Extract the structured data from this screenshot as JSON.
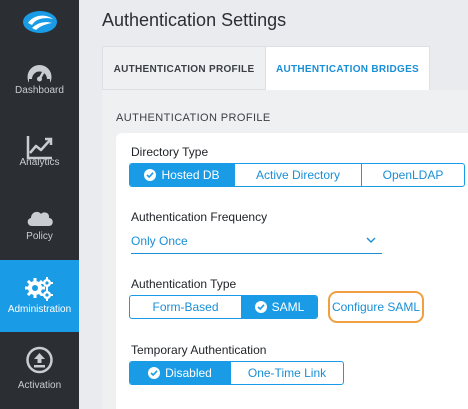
{
  "sidebar": {
    "items": [
      {
        "label": "Dashboard",
        "icon": "dashboard-gauge-icon"
      },
      {
        "label": "Analytics",
        "icon": "analytics-chart-icon"
      },
      {
        "label": "Policy",
        "icon": "cloud-icon"
      },
      {
        "label": "Administration",
        "icon": "gears-icon",
        "active": true
      },
      {
        "label": "Activation",
        "icon": "upload-icon"
      }
    ]
  },
  "header": {
    "title": "Authentication Settings"
  },
  "tabs": [
    {
      "label": "AUTHENTICATION PROFILE"
    },
    {
      "label": "AUTHENTICATION BRIDGES"
    }
  ],
  "section": {
    "title": "AUTHENTICATION PROFILE"
  },
  "directory_type": {
    "label": "Directory Type",
    "options": [
      "Hosted DB",
      "Active Directory",
      "OpenLDAP"
    ],
    "selected": "Hosted DB"
  },
  "auth_frequency": {
    "label": "Authentication Frequency",
    "value": "Only Once"
  },
  "auth_type": {
    "label": "Authentication Type",
    "options": [
      "Form-Based",
      "SAML"
    ],
    "selected": "SAML",
    "config_link": "Configure SAML"
  },
  "temp_auth": {
    "label": "Temporary Authentication",
    "options": [
      "Disabled",
      "One-Time Link"
    ],
    "selected": "Disabled"
  },
  "colors": {
    "accent": "#1a9be6",
    "sidebar_bg": "#2b2e33",
    "highlight_ring": "#f0a040"
  }
}
